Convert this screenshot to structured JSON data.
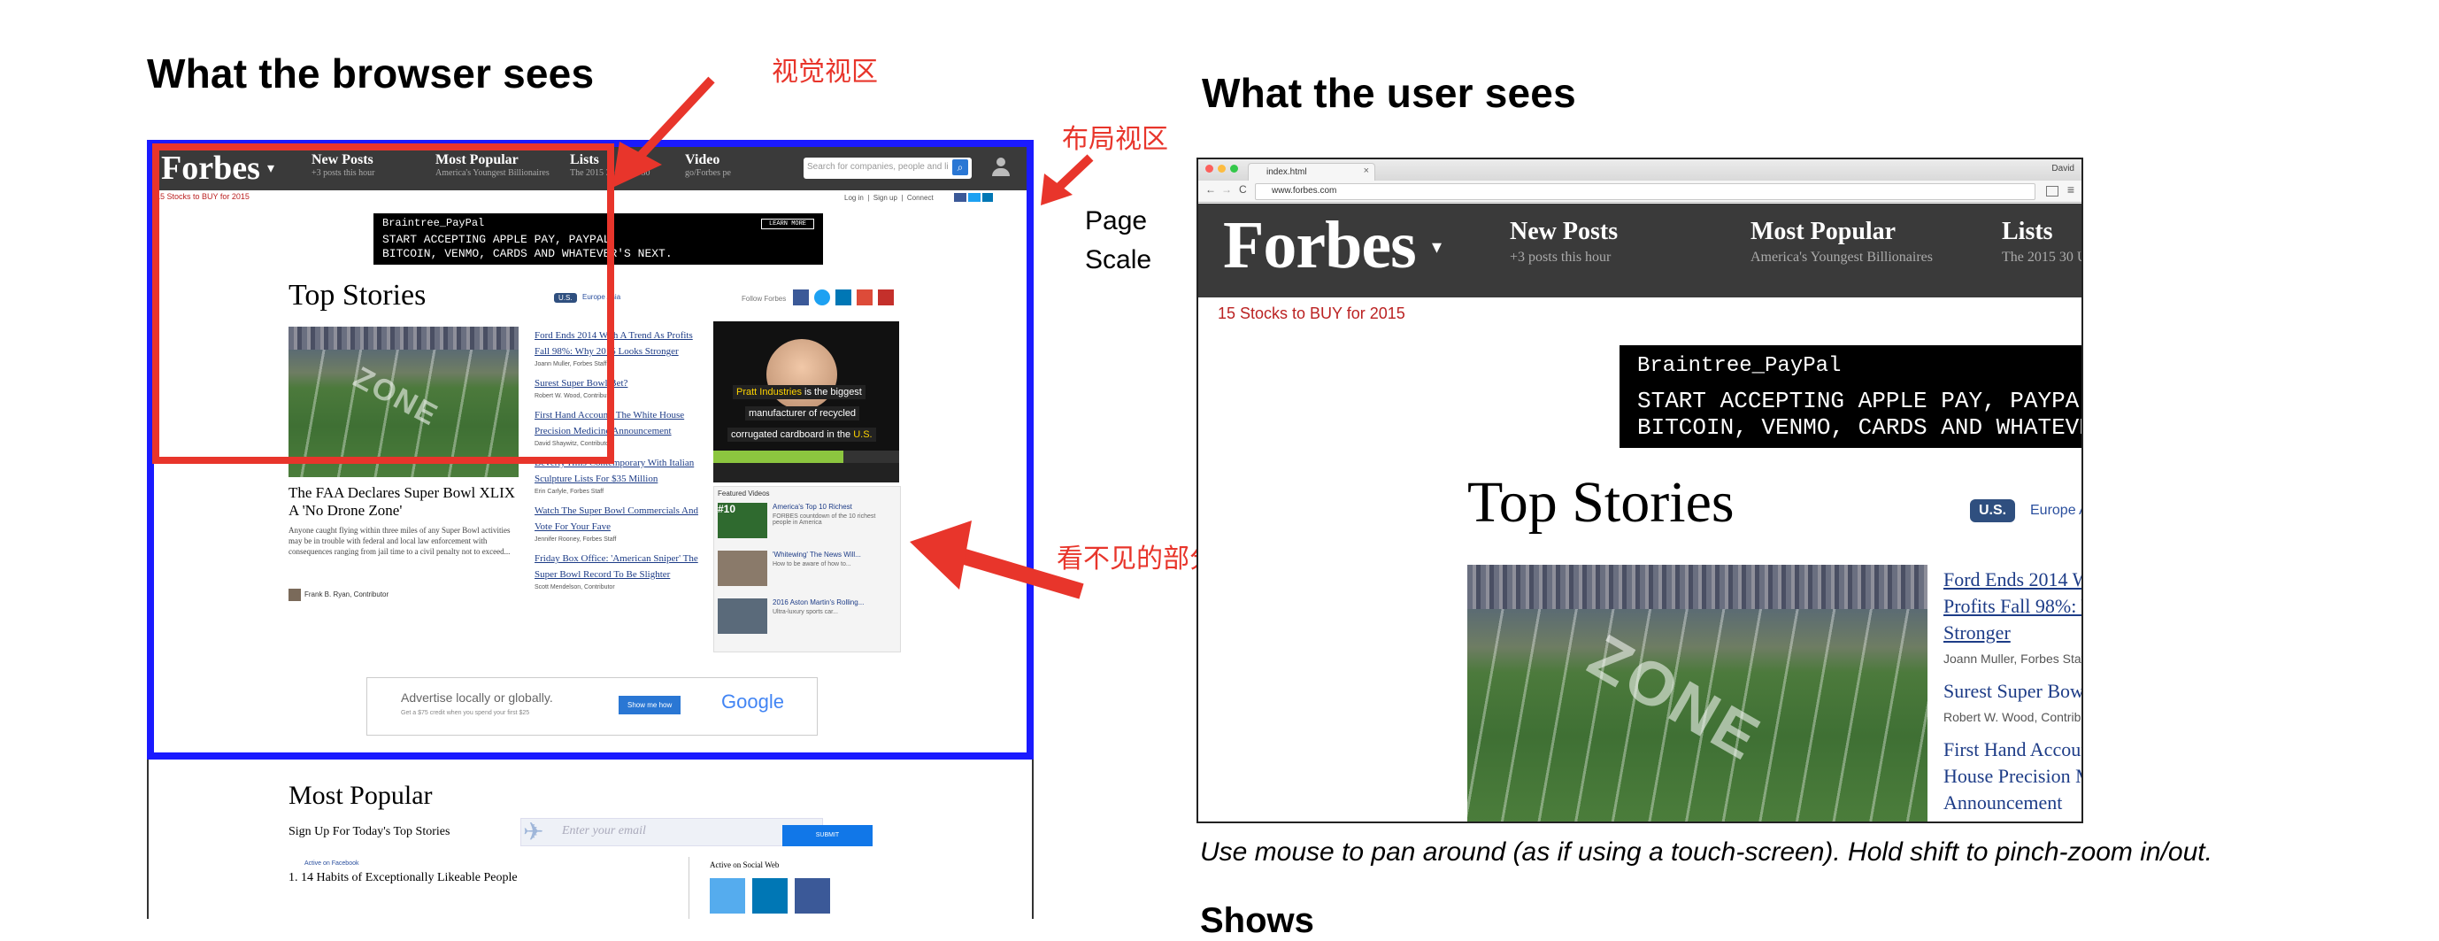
{
  "left": {
    "heading": "What the browser sees",
    "annotations": {
      "visual_viewport": "视觉视区",
      "layout_viewport": "布局视区",
      "page_scale": [
        "Page",
        "Scale"
      ],
      "invisible_part": "看不见的部分"
    },
    "forbes": {
      "logo": "Forbes",
      "nav": [
        {
          "title": "New Posts",
          "sub": "+3 posts this hour"
        },
        {
          "title": "Most Popular",
          "sub": "America's Youngest Billionaires"
        },
        {
          "title": "Lists",
          "sub": "The 2015 30 Under 30"
        },
        {
          "title": "Video",
          "sub": "go/Forbes pe"
        }
      ],
      "search_placeholder": "Search for companies, people and lists",
      "promo_link": "15 Stocks to BUY for 2015",
      "top_links": "Log in  |  Sign up  |  Connect",
      "ad_brand": "Braintree_PayPal",
      "ad_lines": [
        "START ACCEPTING APPLE PAY, PAYPAL,",
        "BITCOIN, VENMO, CARDS AND WHATEVER'S NEXT."
      ],
      "ad_button": "LEARN MORE",
      "top_stories": "Top Stories",
      "region_us": "U.S.",
      "region_europe": "Europe  Asia",
      "follow": "Follow Forbes",
      "main_story_title": "The FAA Declares Super Bowl XLIX A 'No Drone Zone'",
      "main_story_body": "Anyone caught flying within three miles of any Super Bowl activities may be in trouble with federal and local law enforcement with consequences ranging from jail time to a civil penalty not to exceed...",
      "main_story_author": "Frank B. Ryan, Contributor",
      "side_stories": [
        {
          "title": "Ford Ends 2014 With A Trend As Profits Fall 98%: Why 2015 Looks Stronger",
          "author": "Joann Muller, Forbes Staff"
        },
        {
          "title": "Surest Super Bowl Bet?",
          "author": "Robert W. Wood, Contributor"
        },
        {
          "title": "First Hand Account: The White House Precision Medicine Announcement",
          "author": "David Shaywitz, Contributor"
        },
        {
          "title": "Beverly Hills Contemporary With Italian Sculpture Lists For $35 Million",
          "author": "Erin Carlyle, Forbes Staff"
        },
        {
          "title": "Watch The Super Bowl Commercials And Vote For Your Fave",
          "author": "Jennifer Rooney, Forbes Staff"
        },
        {
          "title": "Friday Box Office: 'American Sniper' The Super Bowl Record To Be Slighter",
          "author": "Scott Mendelson, Contributor"
        }
      ],
      "video_ad": {
        "brand": "Pratt Industries",
        "line1": "is the biggest",
        "line2": "manufacturer of recycled",
        "line3": "corrugated cardboard in the",
        "us": "U.S."
      },
      "featured_videos": "Featured Videos",
      "videos": [
        {
          "rank": "#10",
          "title": "America's Top 10 Richest",
          "desc": "FORBES countdown of the 10 richest people in America"
        },
        {
          "rank": "",
          "title": "'Whitewing' The News Will...",
          "desc": "How to be aware of how to..."
        },
        {
          "rank": "",
          "title": "2016 Aston Martin's Rolling...",
          "desc": "Ultra-luxury sports car..."
        }
      ],
      "bottom_ad_text": "Advertise locally or globally.",
      "bottom_ad_sub": "Get a $75 credit when you spend your first $25",
      "bottom_ad_button": "Show me how",
      "bottom_ad_google": "Google",
      "most_popular": "Most Popular",
      "signup": "Sign Up For Today's Top Stories",
      "email_placeholder": "Enter your email",
      "submit": "SUBMIT",
      "popular_item": "1. 14 Habits of Exceptionally Likeable People",
      "active_social": "Active on Social Web",
      "active_facebook": "Active on Facebook"
    }
  },
  "right": {
    "heading": "What the user sees",
    "tab_title": "index.html",
    "url": "www.forbes.com",
    "user": "David",
    "caption": "Use mouse to pan around (as if using a touch-screen). Hold shift to pinch-zoom in/out.",
    "next_heading": "Shows"
  }
}
